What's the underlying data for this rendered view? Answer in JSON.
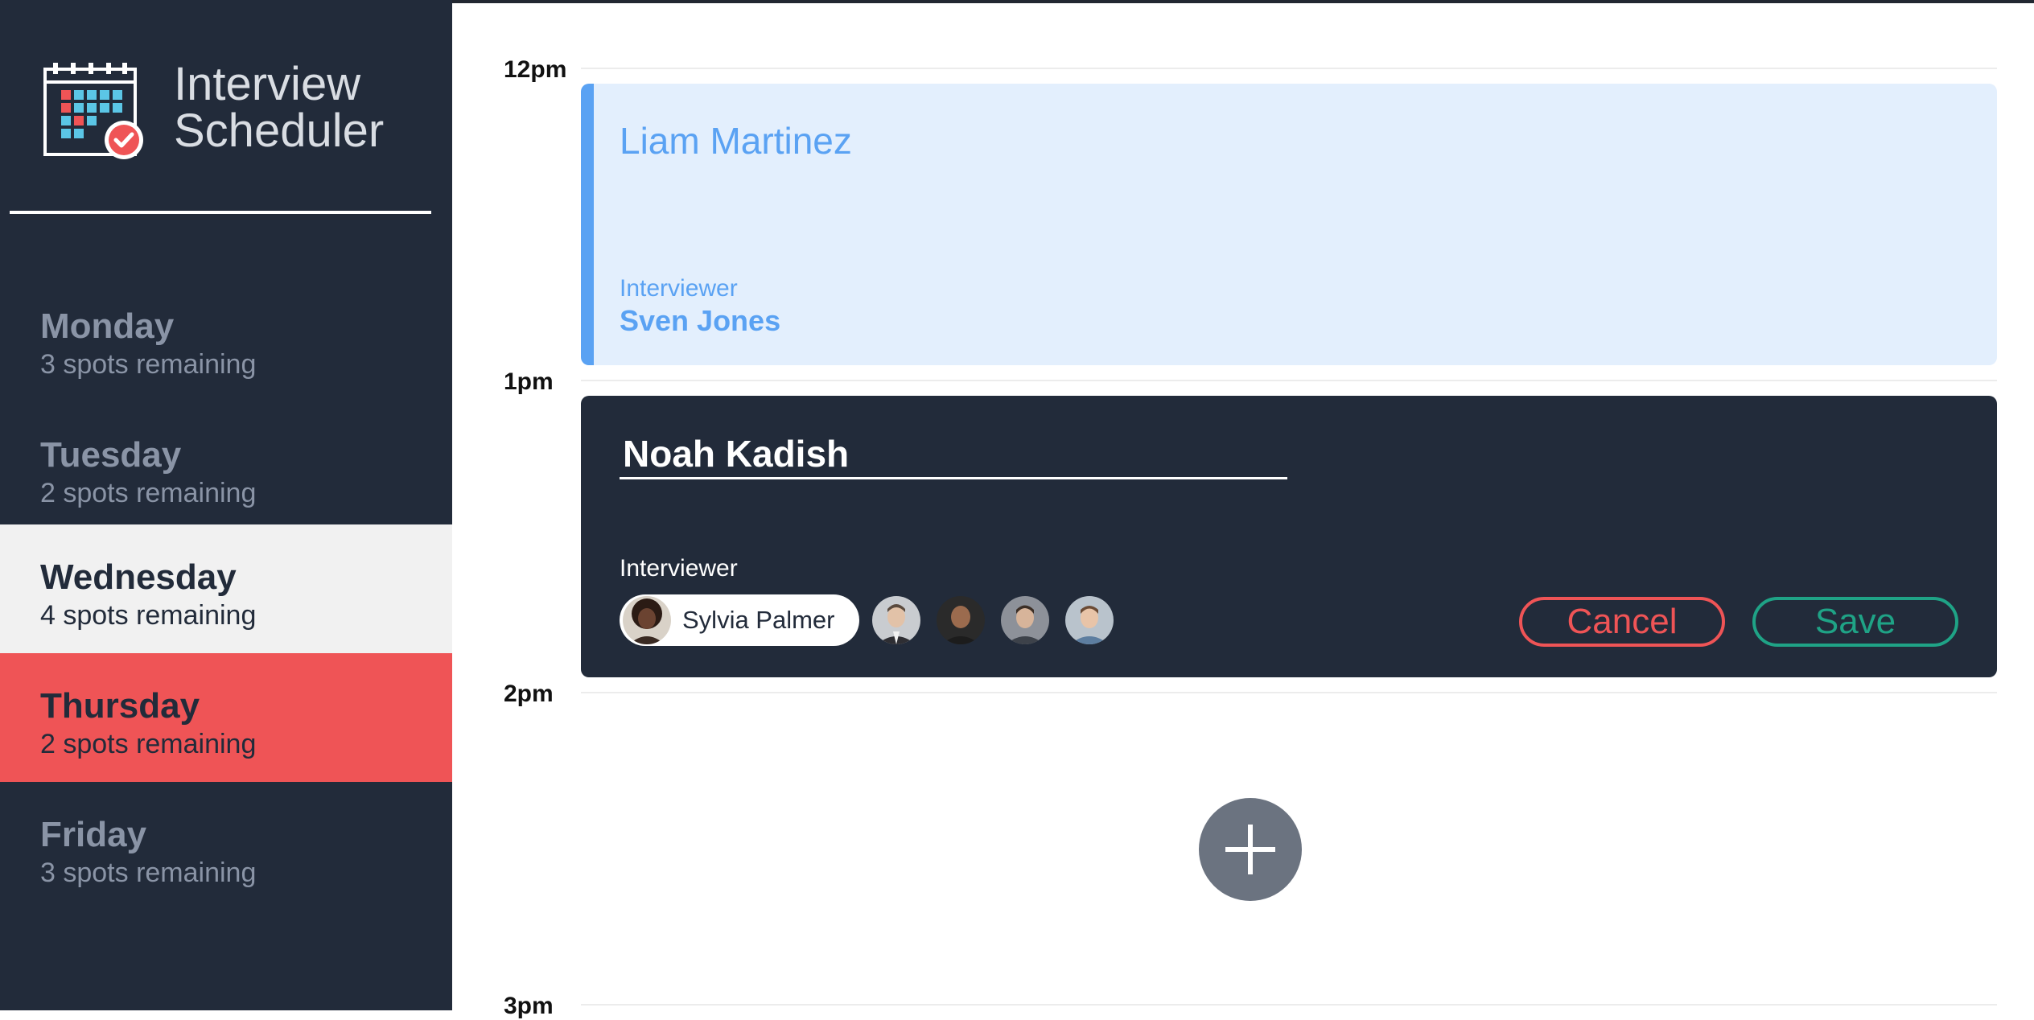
{
  "app": {
    "title_line1": "Interview",
    "title_line2": "Scheduler"
  },
  "days": [
    {
      "name": "Monday",
      "spots": "3 spots remaining"
    },
    {
      "name": "Tuesday",
      "spots": "2 spots remaining"
    },
    {
      "name": "Wednesday",
      "spots": "4 spots remaining"
    },
    {
      "name": "Thursday",
      "spots": "2 spots remaining"
    },
    {
      "name": "Friday",
      "spots": "3 spots remaining"
    }
  ],
  "schedule": {
    "times": [
      "12pm",
      "1pm",
      "2pm",
      "3pm"
    ],
    "booked": {
      "student": "Liam Martinez",
      "interviewer_label": "Interviewer",
      "interviewer": "Sven Jones"
    },
    "form": {
      "student_value": "Noah Kadish",
      "interviewer_label": "Interviewer",
      "selected_interviewer": "Sylvia Palmer",
      "cancel_label": "Cancel",
      "save_label": "Save"
    }
  },
  "colors": {
    "sidebar": "#222b3a",
    "selected_day": "#f1f1f1",
    "full_day": "#ef5456",
    "booked_accent": "#5aa2f3",
    "booked_bg": "#e3effd",
    "cancel": "#ef5456",
    "save": "#1fa386",
    "add_button": "#6b7380"
  },
  "icons": {
    "logo": "calendar-check-icon",
    "add": "plus-icon"
  }
}
